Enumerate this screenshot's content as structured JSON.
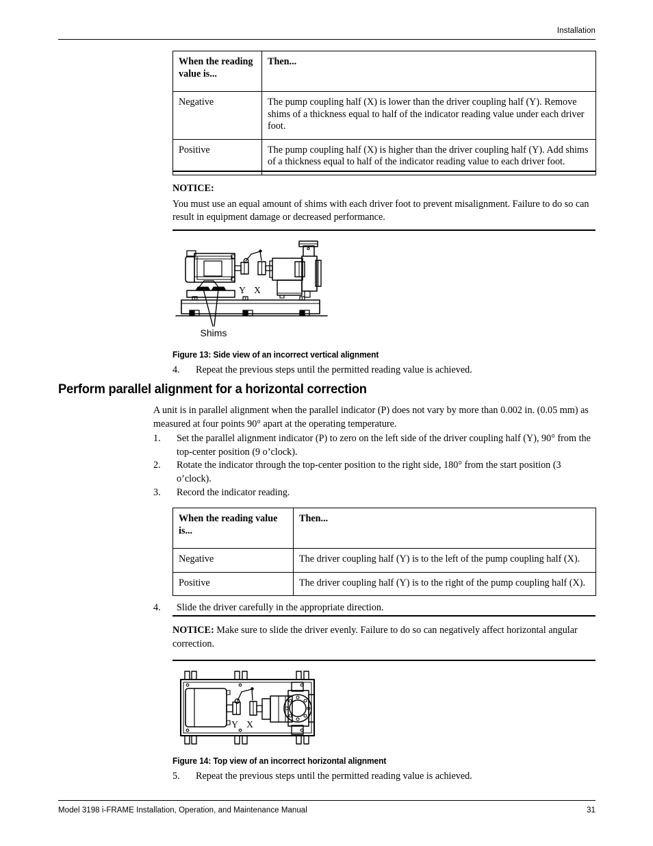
{
  "header": {
    "title": "Installation"
  },
  "table_vertical": {
    "headers": [
      "When the reading value is...",
      "Then..."
    ],
    "rows": [
      {
        "value": "Negative",
        "result": "The pump coupling half (X) is lower than the driver coupling half (Y). Remove shims of a thickness equal to half of the indicator reading value under each driver foot."
      },
      {
        "value": "Positive",
        "result": "The pump coupling half (X) is higher than the driver coupling half (Y). Add shims of a thickness equal to half of the indicator reading value to each driver foot."
      }
    ]
  },
  "notice_vertical": {
    "label": "NOTICE:",
    "text": "You must use an equal amount of shims with each driver foot to prevent misalignment. Failure to do so can result in equipment damage or decreased performance."
  },
  "figure_13": {
    "caption": "Figure 13: Side view of an incorrect vertical alignment",
    "labels": {
      "driver_half": "Y",
      "pump_half": "X",
      "shims": "Shims"
    }
  },
  "step_vertical_4": {
    "number": "4.",
    "text": "Repeat the previous steps until the permitted reading value is achieved."
  },
  "section": {
    "heading": "Perform parallel alignment for a horizontal correction",
    "intro": "A unit is in parallel alignment when the parallel indicator (P) does not vary by more than 0.002 in. (0.05 mm) as measured at four points 90° apart at the operating temperature.",
    "steps": [
      {
        "number": "1.",
        "text": "Set the parallel alignment indicator (P) to zero on the left side of the driver coupling half (Y), 90° from the top-center position (9 o’clock)."
      },
      {
        "number": "2.",
        "text": "Rotate the indicator through the top-center position to the right side, 180° from the start position (3 o’clock)."
      },
      {
        "number": "3.",
        "text": "Record the indicator reading."
      }
    ]
  },
  "table_horizontal": {
    "headers": [
      "When the reading value is...",
      "Then..."
    ],
    "rows": [
      {
        "value": "Negative",
        "result": "The driver coupling half (Y) is to the left of the pump coupling half (X)."
      },
      {
        "value": "Positive",
        "result": "The driver coupling half (Y) is to the right of the pump coupling half (X)."
      }
    ]
  },
  "step_horizontal_4": {
    "number": "4.",
    "text": "Slide the driver carefully in the appropriate direction."
  },
  "notice_horizontal": {
    "label": "NOTICE:",
    "text": "Make sure to slide the driver evenly. Failure to do so can negatively affect horizontal angular correction."
  },
  "figure_14": {
    "caption": "Figure 14: Top view of an incorrect horizontal alignment",
    "labels": {
      "driver_half": "Y",
      "pump_half": "X"
    }
  },
  "step_horizontal_5": {
    "number": "5.",
    "text": "Repeat the previous steps until the permitted reading value is achieved."
  },
  "footer": {
    "manual": "Model 3198 i-FRAME Installation, Operation, and Maintenance Manual",
    "page": "31"
  },
  "colors": {
    "ink": "#000000",
    "paper": "#ffffff"
  }
}
